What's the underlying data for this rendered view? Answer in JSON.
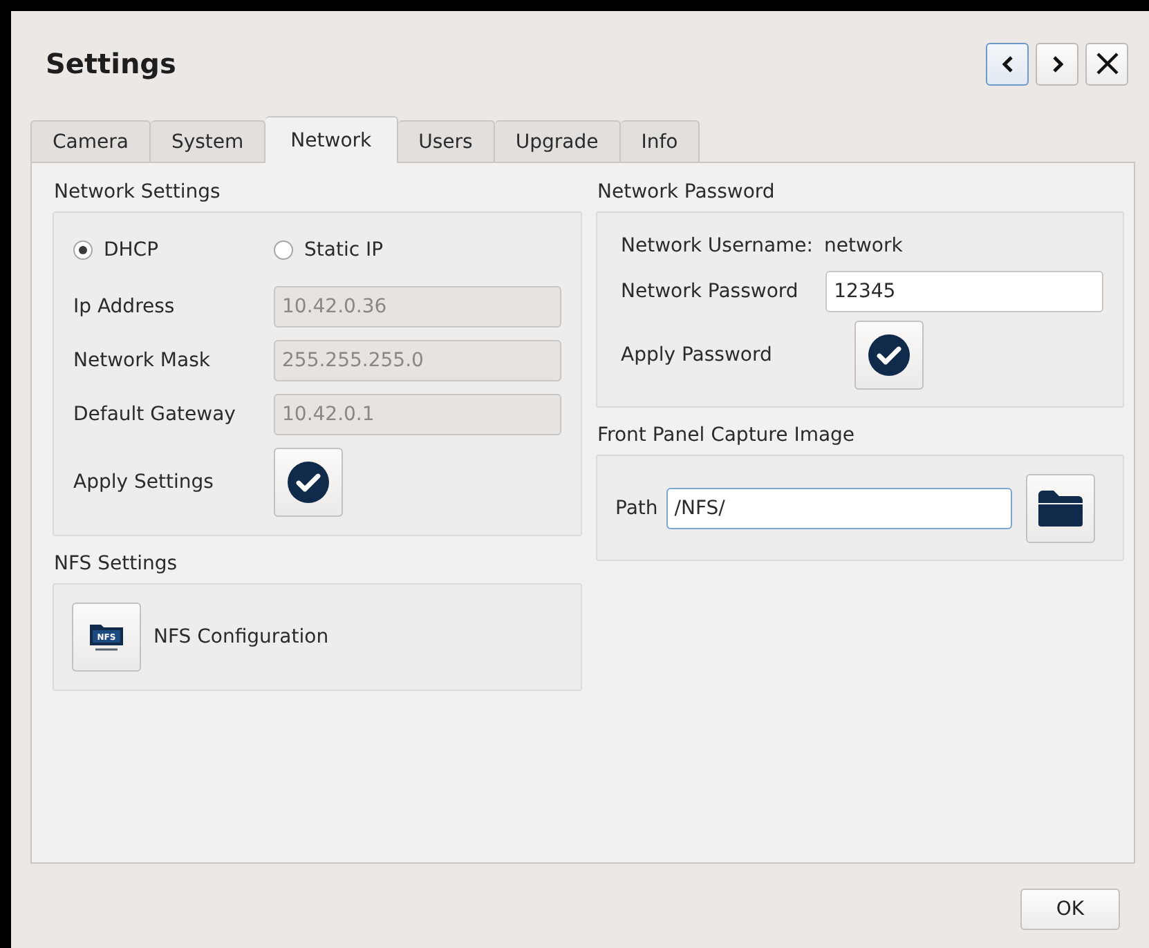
{
  "window": {
    "title": "Settings",
    "nav_buttons": [
      {
        "kind": "prev",
        "focused": true
      },
      {
        "kind": "next",
        "focused": false
      },
      {
        "kind": "close",
        "focused": false
      }
    ]
  },
  "tabs": [
    {
      "label": "Camera",
      "selected": false
    },
    {
      "label": "System",
      "selected": false
    },
    {
      "label": "Network",
      "selected": true
    },
    {
      "label": "Users",
      "selected": false
    },
    {
      "label": "Upgrade",
      "selected": false
    },
    {
      "label": "Info",
      "selected": false
    }
  ],
  "network_settings": {
    "title": "Network Settings",
    "modes": [
      {
        "label": "DHCP",
        "selected": true
      },
      {
        "label": "Static IP",
        "selected": false
      }
    ],
    "fields": [
      {
        "label": "Ip Address",
        "value": "10.42.0.36",
        "disabled": true
      },
      {
        "label": "Network Mask",
        "value": "255.255.255.0",
        "disabled": true
      },
      {
        "label": "Default Gateway",
        "value": "10.42.0.1",
        "disabled": true
      }
    ],
    "apply_label": "Apply Settings"
  },
  "nfs_settings": {
    "title": "NFS Settings",
    "icon_label": "NFS",
    "button_label": "NFS Configuration"
  },
  "network_password": {
    "title": "Network Password",
    "username_label": "Network Username:",
    "username_value": "network",
    "password_label": "Network Password",
    "password_value": "12345",
    "apply_label": "Apply Password"
  },
  "capture_image": {
    "title": "Front Panel Capture Image",
    "path_label": "Path",
    "path_value": "/NFS/",
    "path_focused": true
  },
  "buttons": [
    {
      "label": "OK"
    }
  ]
}
